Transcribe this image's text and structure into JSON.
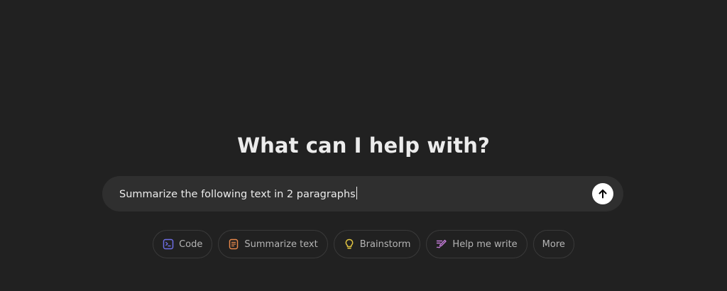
{
  "heading": "What can I help with?",
  "composer": {
    "value": "Summarize the following text in 2 paragraphs",
    "send_icon": "arrow-up-icon"
  },
  "suggestions": [
    {
      "label": "Code",
      "icon": "terminal-icon",
      "color": "#6e6ee6"
    },
    {
      "label": "Summarize text",
      "icon": "document-icon",
      "color": "#e8884a"
    },
    {
      "label": "Brainstorm",
      "icon": "lightbulb-icon",
      "color": "#e2c541"
    },
    {
      "label": "Help me write",
      "icon": "pen-icon",
      "color": "#c77ddb"
    },
    {
      "label": "More",
      "icon": "",
      "color": ""
    }
  ]
}
